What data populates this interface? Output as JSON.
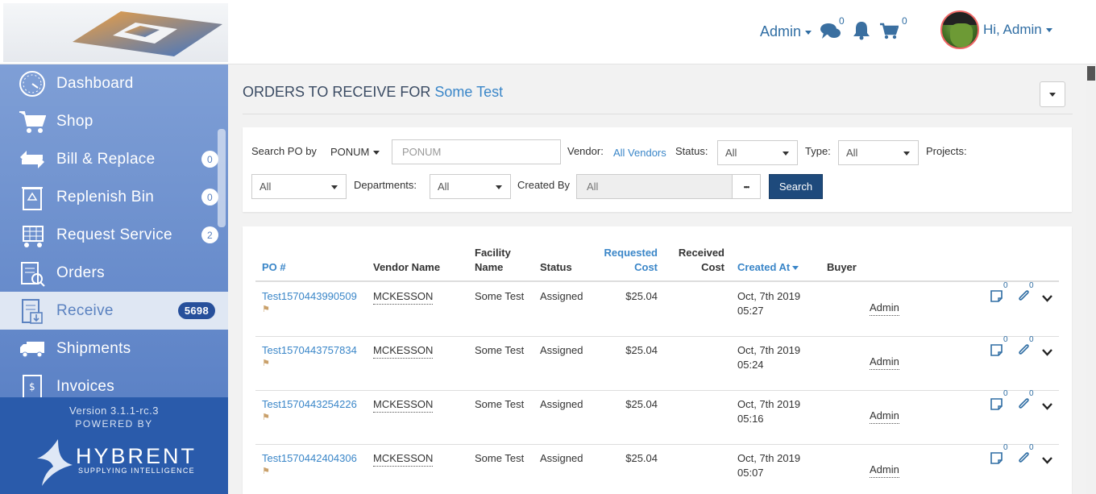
{
  "header": {
    "admin_menu": "Admin",
    "messages_count": "0",
    "cart_count": "0",
    "greeting": "Hi, Admin"
  },
  "sidebar": {
    "items": [
      {
        "label": "Dashboard",
        "icon": "dashboard-icon",
        "badge": ""
      },
      {
        "label": "Shop",
        "icon": "cart-icon",
        "badge": ""
      },
      {
        "label": "Bill & Replace",
        "icon": "bill-replace-icon",
        "badge": "0"
      },
      {
        "label": "Replenish Bin",
        "icon": "recycle-bin-icon",
        "badge": "0"
      },
      {
        "label": "Request Service",
        "icon": "service-cart-icon",
        "badge": "2"
      },
      {
        "label": "Orders",
        "icon": "orders-icon",
        "badge": ""
      },
      {
        "label": "Receive",
        "icon": "receive-icon",
        "badge": "5698"
      },
      {
        "label": "Shipments",
        "icon": "truck-icon",
        "badge": ""
      },
      {
        "label": "Invoices",
        "icon": "invoice-icon",
        "badge": ""
      }
    ],
    "version": "Version 3.1.1-rc.3",
    "powered_by": "POWERED BY",
    "brand": "HYBRENT",
    "brand_sub": "SUPPLYING INTELLIGENCE"
  },
  "page": {
    "title_prefix": "ORDERS TO RECEIVE FOR",
    "facility": "Some Test"
  },
  "filters": {
    "search_po_by_label": "Search PO by",
    "search_po_by_value": "PONUM",
    "search_placeholder": "PONUM",
    "vendor_label": "Vendor:",
    "vendor_value": "All Vendors",
    "status_label": "Status:",
    "status_value": "All",
    "type_label": "Type:",
    "type_value": "All",
    "projects_label": "Projects:",
    "projects_value": "All",
    "departments_label": "Departments:",
    "departments_value": "All",
    "created_by_label": "Created By",
    "created_by_value": "All",
    "dots": "•••",
    "search_button": "Search"
  },
  "table": {
    "headers": {
      "po": "PO #",
      "vendor": "Vendor Name",
      "facility_1": "Facility",
      "facility_2": "Name",
      "status": "Status",
      "requested_1": "Requested",
      "requested_2": "Cost",
      "received_1": "Received",
      "received_2": "Cost",
      "created_at": "Created At",
      "buyer": "Buyer"
    },
    "rows": [
      {
        "po": "Test1570443990509",
        "vendor": "MCKESSON",
        "facility": "Some Test",
        "status": "Assigned",
        "requested_cost": "$25.04",
        "received_cost": "",
        "created_date": "Oct, 7th 2019",
        "created_time": "05:27",
        "buyer": "Admin",
        "notes_count": "0",
        "attach_count": "0"
      },
      {
        "po": "Test1570443757834",
        "vendor": "MCKESSON",
        "facility": "Some Test",
        "status": "Assigned",
        "requested_cost": "$25.04",
        "received_cost": "",
        "created_date": "Oct, 7th 2019",
        "created_time": "05:24",
        "buyer": "Admin",
        "notes_count": "0",
        "attach_count": "0"
      },
      {
        "po": "Test1570443254226",
        "vendor": "MCKESSON",
        "facility": "Some Test",
        "status": "Assigned",
        "requested_cost": "$25.04",
        "received_cost": "",
        "created_date": "Oct, 7th 2019",
        "created_time": "05:16",
        "buyer": "Admin",
        "notes_count": "0",
        "attach_count": "0"
      },
      {
        "po": "Test1570442404306",
        "vendor": "MCKESSON",
        "facility": "Some Test",
        "status": "Assigned",
        "requested_cost": "$25.04",
        "received_cost": "",
        "created_date": "Oct, 7th 2019",
        "created_time": "05:07",
        "buyer": "Admin",
        "notes_count": "0",
        "attach_count": "0"
      }
    ]
  }
}
